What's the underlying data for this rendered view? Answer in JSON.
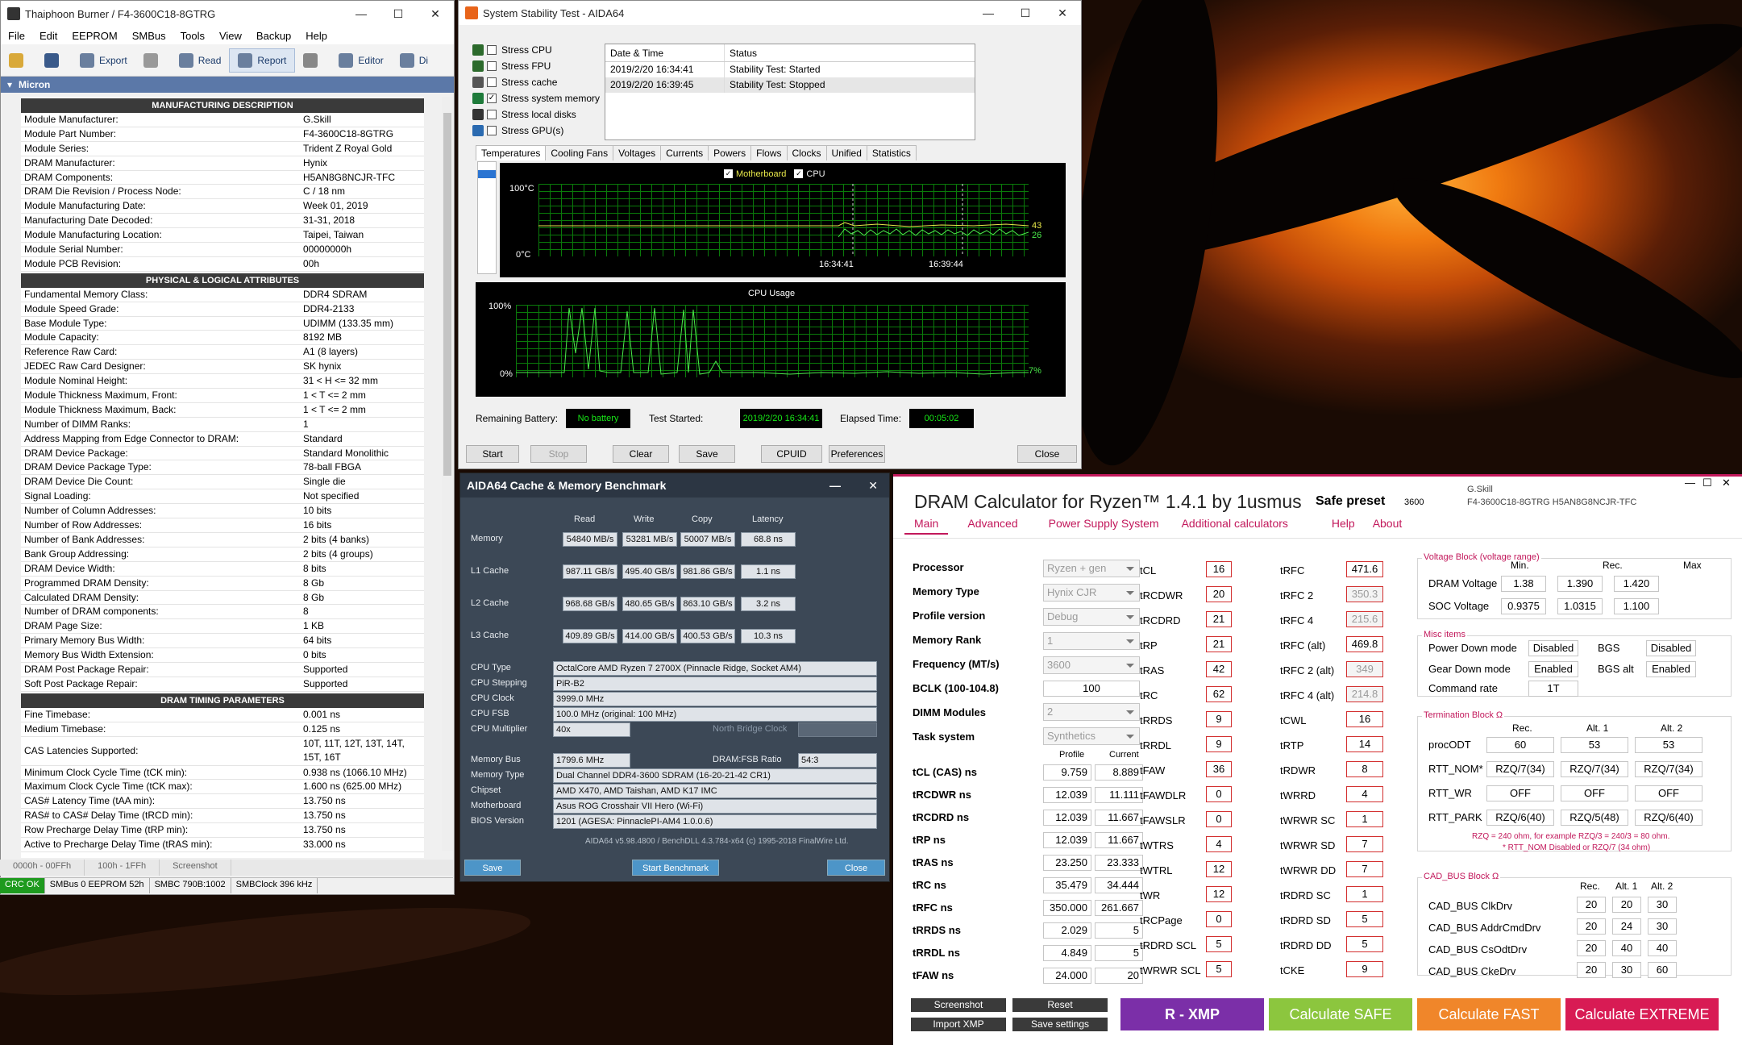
{
  "thaiphoon": {
    "title": "Thaiphoon Burner / F4-3600C18-8GTRG",
    "menu": [
      "File",
      "Edit",
      "EEPROM",
      "SMBus",
      "Tools",
      "View",
      "Backup",
      "Help"
    ],
    "toolbar": {
      "export": "Export",
      "read": "Read",
      "report": "Report",
      "editor": "Editor",
      "dump": "Di"
    },
    "module_band": "Micron",
    "sections": [
      {
        "title": "MANUFACTURING DESCRIPTION",
        "rows": [
          [
            "Module Manufacturer:",
            "G.Skill"
          ],
          [
            "Module Part Number:",
            "F4-3600C18-8GTRG"
          ],
          [
            "Module Series:",
            "Trident Z Royal Gold"
          ],
          [
            "DRAM Manufacturer:",
            "Hynix"
          ],
          [
            "DRAM Components:",
            "H5AN8G8NCJR-TFC"
          ],
          [
            "DRAM Die Revision / Process Node:",
            "C / 18 nm"
          ],
          [
            "Module Manufacturing Date:",
            "Week 01, 2019"
          ],
          [
            "Manufacturing Date Decoded:",
            "31-31, 2018"
          ],
          [
            "Module Manufacturing Location:",
            "Taipei, Taiwan"
          ],
          [
            "Module Serial Number:",
            "00000000h"
          ],
          [
            "Module PCB Revision:",
            "00h"
          ]
        ]
      },
      {
        "title": "PHYSICAL & LOGICAL ATTRIBUTES",
        "rows": [
          [
            "Fundamental Memory Class:",
            "DDR4 SDRAM"
          ],
          [
            "Module Speed Grade:",
            "DDR4-2133"
          ],
          [
            "Base Module Type:",
            "UDIMM (133.35 mm)"
          ],
          [
            "Module Capacity:",
            "8192 MB"
          ],
          [
            "Reference Raw Card:",
            "A1 (8 layers)"
          ],
          [
            "JEDEC Raw Card Designer:",
            "SK hynix"
          ],
          [
            "Module Nominal Height:",
            "31 < H <= 32 mm"
          ],
          [
            "Module Thickness Maximum, Front:",
            "1 < T <= 2 mm"
          ],
          [
            "Module Thickness Maximum, Back:",
            "1 < T <= 2 mm"
          ],
          [
            "Number of DIMM Ranks:",
            "1"
          ],
          [
            "Address Mapping from Edge Connector to DRAM:",
            "Standard"
          ],
          [
            "DRAM Device Package:",
            "Standard Monolithic"
          ],
          [
            "DRAM Device Package Type:",
            "78-ball FBGA"
          ],
          [
            "DRAM Device Die Count:",
            "Single die"
          ],
          [
            "Signal Loading:",
            "Not specified"
          ],
          [
            "Number of Column Addresses:",
            "10 bits"
          ],
          [
            "Number of Row Addresses:",
            "16 bits"
          ],
          [
            "Number of Bank Addresses:",
            "2 bits (4 banks)"
          ],
          [
            "Bank Group Addressing:",
            "2 bits (4 groups)"
          ],
          [
            "DRAM Device Width:",
            "8 bits"
          ],
          [
            "Programmed DRAM Density:",
            "8 Gb"
          ],
          [
            "Calculated DRAM Density:",
            "8 Gb"
          ],
          [
            "Number of DRAM components:",
            "8"
          ],
          [
            "DRAM Page Size:",
            "1 KB"
          ],
          [
            "Primary Memory Bus Width:",
            "64 bits"
          ],
          [
            "Memory Bus Width Extension:",
            "0 bits"
          ],
          [
            "DRAM Post Package Repair:",
            "Supported"
          ],
          [
            "Soft Post Package Repair:",
            "Supported"
          ]
        ]
      },
      {
        "title": "DRAM TIMING PARAMETERS",
        "rows": [
          [
            "Fine Timebase:",
            "0.001 ns"
          ],
          [
            "Medium Timebase:",
            "0.125 ns"
          ],
          [
            "CAS Latencies Supported:",
            "10T, 11T, 12T, 13T, 14T, 15T, 16T"
          ],
          [
            "Minimum Clock Cycle Time (tCK min):",
            "0.938 ns (1066.10 MHz)"
          ],
          [
            "Maximum Clock Cycle Time (tCK max):",
            "1.600 ns (625.00 MHz)"
          ],
          [
            "CAS# Latency Time (tAA min):",
            "13.750 ns"
          ],
          [
            "RAS# to CAS# Delay Time (tRCD min):",
            "13.750 ns"
          ],
          [
            "Row Precharge Delay Time (tRP min):",
            "13.750 ns"
          ],
          [
            "Active to Precharge Delay Time (tRAS min):",
            "33.000 ns"
          ]
        ]
      }
    ],
    "bottom_tabs": [
      "0000h - 00FFh",
      "100h - 1FFh",
      "Screenshot"
    ],
    "status": [
      "CRC OK",
      "SMBus 0 EEPROM 52h",
      "SMBC 790B:1002",
      "SMBClock 396 kHz"
    ]
  },
  "stability": {
    "title": "System Stability Test - AIDA64",
    "stress": [
      {
        "label": "Stress CPU",
        "checked": false
      },
      {
        "label": "Stress FPU",
        "checked": false
      },
      {
        "label": "Stress cache",
        "checked": false
      },
      {
        "label": "Stress system memory",
        "checked": true
      },
      {
        "label": "Stress local disks",
        "checked": false
      },
      {
        "label": "Stress GPU(s)",
        "checked": false
      }
    ],
    "log_headers": [
      "Date & Time",
      "Status"
    ],
    "log_rows": [
      [
        "2019/2/20 16:34:41",
        "Stability Test: Started"
      ],
      [
        "2019/2/20 16:39:45",
        "Stability Test: Stopped"
      ]
    ],
    "tabs": [
      "Temperatures",
      "Cooling Fans",
      "Voltages",
      "Currents",
      "Powers",
      "Flows",
      "Clocks",
      "Unified",
      "Statistics"
    ],
    "temp_legend": [
      "Motherboard",
      "CPU"
    ],
    "temp_axis": {
      "top": "100°C",
      "bottom": "0°C",
      "t1": "16:34:41",
      "t2": "16:39:44",
      "v1": "43",
      "v2": "26"
    },
    "cpu_title": "CPU Usage",
    "cpu_axis": {
      "top": "100%",
      "bottom": "0%",
      "end": "7%"
    },
    "remaining_label": "Remaining Battery:",
    "remaining_value": "No battery",
    "started_label": "Test Started:",
    "started_value": "2019/2/20 16:34:41",
    "elapsed_label": "Elapsed Time:",
    "elapsed_value": "00:05:02",
    "buttons": [
      "Start",
      "Stop",
      "Clear",
      "Save",
      "CPUID",
      "Preferences",
      "Close"
    ]
  },
  "bench": {
    "title": "AIDA64 Cache & Memory Benchmark",
    "cols": [
      "Read",
      "Write",
      "Copy",
      "Latency"
    ],
    "rows": [
      {
        "label": "Memory",
        "v": [
          "54840 MB/s",
          "53281 MB/s",
          "50007 MB/s",
          "68.8 ns"
        ]
      },
      {
        "label": "L1 Cache",
        "v": [
          "987.11 GB/s",
          "495.40 GB/s",
          "981.86 GB/s",
          "1.1 ns"
        ]
      },
      {
        "label": "L2 Cache",
        "v": [
          "968.68 GB/s",
          "480.65 GB/s",
          "863.10 GB/s",
          "3.2 ns"
        ]
      },
      {
        "label": "L3 Cache",
        "v": [
          "409.89 GB/s",
          "414.00 GB/s",
          "400.53 GB/s",
          "10.3 ns"
        ]
      }
    ],
    "info": [
      [
        "CPU Type",
        "OctalCore AMD Ryzen 7 2700X  (Pinnacle Ridge, Socket AM4)"
      ],
      [
        "CPU Stepping",
        "PiR-B2"
      ],
      [
        "CPU Clock",
        "3999.0 MHz"
      ],
      [
        "CPU FSB",
        "100.0 MHz  (original: 100 MHz)"
      ],
      [
        "CPU Multiplier",
        "40x"
      ]
    ],
    "nb_label": "North Bridge Clock",
    "info2": [
      [
        "Memory Bus",
        "1799.6 MHz"
      ],
      [
        "Memory Type",
        "Dual Channel DDR4-3600 SDRAM  (16-20-21-42 CR1)"
      ],
      [
        "Chipset",
        "AMD X470, AMD Taishan, AMD K17 IMC"
      ],
      [
        "Motherboard",
        "Asus ROG Crosshair VII Hero (Wi-Fi)"
      ],
      [
        "BIOS Version",
        "1201  (AGESA: PinnaclePI-AM4 1.0.0.6)"
      ]
    ],
    "ratio_label": "DRAM:FSB Ratio",
    "ratio_value": "54:3",
    "footer": "AIDA64 v5.98.4800 / BenchDLL 4.3.784-x64  (c) 1995-2018 FinalWire Ltd.",
    "buttons": [
      "Save",
      "Start Benchmark",
      "Close"
    ]
  },
  "calc": {
    "title": "DRAM Calculator for Ryzen™ 1.4.1 by 1usmus",
    "preset_label": "Safe preset",
    "preset_value": "3600",
    "module_line1": "G.Skill",
    "module_line2": "F4-3600C18-8GTRG  H5AN8G8NCJR-TFC",
    "nav": [
      "Main",
      "Advanced",
      "Power Supply System",
      "Additional calculators",
      "Help",
      "About"
    ],
    "settings": [
      [
        "Processor",
        "Ryzen + gen"
      ],
      [
        "Memory Type",
        "Hynix CJR"
      ],
      [
        "Profile version",
        "Debug"
      ],
      [
        "Memory Rank",
        "1"
      ],
      [
        "Frequency (MT/s)",
        "3600"
      ]
    ],
    "bclk_label": "BCLK (100-104.8)",
    "bclk_value": "100",
    "dimm_label": "DIMM Modules",
    "dimm_value": "2",
    "task_label": "Task system",
    "task_value": "Synthetics",
    "pc_headers": [
      "Profile",
      "Current"
    ],
    "pc_rows": [
      [
        "tCL (CAS) ns",
        "9.759",
        "8.889"
      ],
      [
        "tRCDWR ns",
        "12.039",
        "11.111"
      ],
      [
        "tRCDRD ns",
        "12.039",
        "11.667"
      ],
      [
        "tRP ns",
        "12.039",
        "11.667"
      ],
      [
        "tRAS ns",
        "23.250",
        "23.333"
      ],
      [
        "tRC ns",
        "35.479",
        "34.444"
      ],
      [
        "tRFC ns",
        "350.000",
        "261.667"
      ],
      [
        "tRRDS ns",
        "2.029",
        "5"
      ],
      [
        "tRRDL ns",
        "4.849",
        "5"
      ],
      [
        "tFAW ns",
        "24.000",
        "20"
      ]
    ],
    "t1": [
      [
        "tCL",
        "16"
      ],
      [
        "tRCDWR",
        "20"
      ],
      [
        "tRCDRD",
        "21"
      ],
      [
        "tRP",
        "21"
      ],
      [
        "tRAS",
        "42"
      ],
      [
        "tRC",
        "62"
      ],
      [
        "tRRDS",
        "9"
      ],
      [
        "tRRDL",
        "9"
      ],
      [
        "tFAW",
        "36"
      ],
      [
        "tFAWDLR",
        "0"
      ],
      [
        "tFAWSLR",
        "0"
      ],
      [
        "tWTRS",
        "4"
      ],
      [
        "tWTRL",
        "12"
      ],
      [
        "tWR",
        "12"
      ],
      [
        "tRCPage",
        "0"
      ],
      [
        "tRDRD SCL",
        "5"
      ],
      [
        "tWRWR SCL",
        "5"
      ]
    ],
    "t2": [
      [
        "tRFC",
        "471.6"
      ],
      [
        "tRFC 2",
        "350.3"
      ],
      [
        "tRFC 4",
        "215.6"
      ],
      [
        "tRFC (alt)",
        "469.8"
      ],
      [
        "tRFC 2 (alt)",
        "349"
      ],
      [
        "tRFC 4 (alt)",
        "214.8"
      ],
      [
        "tCWL",
        "16"
      ],
      [
        "tRTP",
        "14"
      ],
      [
        "tRDWR",
        "8"
      ],
      [
        "tWRRD",
        "4"
      ],
      [
        "tWRWR SC",
        "1"
      ],
      [
        "tWRWR SD",
        "7"
      ],
      [
        "tWRWR DD",
        "7"
      ],
      [
        "tRDRD SC",
        "1"
      ],
      [
        "tRDRD SD",
        "5"
      ],
      [
        "tRDRD DD",
        "5"
      ],
      [
        "tCKE",
        "9"
      ]
    ],
    "voltage": {
      "title": "Voltage Block (voltage range)",
      "headers": [
        "Min.",
        "Rec.",
        "Max"
      ],
      "rows": [
        [
          "DRAM Voltage",
          "1.38",
          "1.390",
          "1.420"
        ],
        [
          "SOC Voltage",
          "0.9375",
          "1.0315",
          "1.100"
        ]
      ]
    },
    "misc": {
      "title": "Misc items",
      "pdm_label": "Power Down mode",
      "pdm": "Disabled",
      "bgs_label": "BGS",
      "bgs": "Disabled",
      "gdm_label": "Gear Down mode",
      "gdm": "Enabled",
      "bgsalt_label": "BGS alt",
      "bgsalt": "Enabled",
      "cr_label": "Command rate",
      "cr": "1T"
    },
    "term": {
      "title": "Termination Block Ω",
      "headers": [
        "Rec.",
        "Alt. 1",
        "Alt. 2"
      ],
      "rows": [
        [
          "procODT",
          "60",
          "53",
          "53"
        ],
        [
          "RTT_NOM*",
          "RZQ/7(34)",
          "RZQ/7(34)",
          "RZQ/7(34)"
        ],
        [
          "RTT_WR",
          "OFF",
          "OFF",
          "OFF"
        ],
        [
          "RTT_PARK",
          "RZQ/6(40)",
          "RZQ/5(48)",
          "RZQ/6(40)"
        ]
      ],
      "note1": "RZQ = 240 ohm, for example RZQ/3 = 240/3 = 80 ohm.",
      "note2": "* RTT_NOM Disabled or RZQ/7 (34 ohm)"
    },
    "cad": {
      "title": "CAD_BUS Block Ω",
      "headers": [
        "Rec.",
        "Alt. 1",
        "Alt. 2"
      ],
      "rows": [
        [
          "CAD_BUS ClkDrv",
          "20",
          "20",
          "30"
        ],
        [
          "CAD_BUS AddrCmdDrv",
          "20",
          "24",
          "30"
        ],
        [
          "CAD_BUS CsOdtDrv",
          "20",
          "40",
          "40"
        ],
        [
          "CAD_BUS CkeDrv",
          "20",
          "30",
          "60"
        ]
      ]
    },
    "small_buttons": [
      "Screenshot",
      "Reset",
      "Import XMP",
      "Save settings"
    ],
    "big_buttons": [
      "R - XMP",
      "Calculate SAFE",
      "Calculate FAST",
      "Calculate EXTREME"
    ],
    "colors": {
      "accent": "#c2185b",
      "xmp": "#7b2fa8",
      "safe": "#8cc63e",
      "fast": "#f0862a",
      "extreme": "#d81b54"
    }
  }
}
